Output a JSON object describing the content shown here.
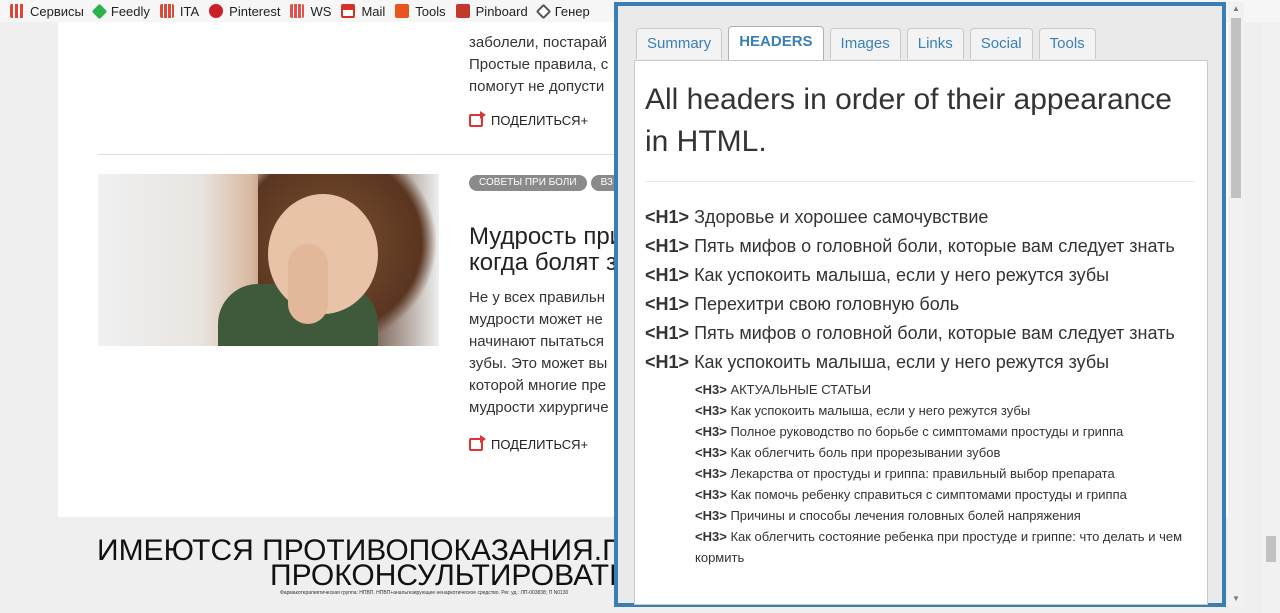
{
  "bookmarks": [
    {
      "label": "Сервисы",
      "icon": "apps-grid-icon",
      "color": "#e34234"
    },
    {
      "label": "Feedly",
      "icon": "feedly-icon",
      "color": "#2bb24c"
    },
    {
      "label": "ITA",
      "icon": "ita-icon",
      "color": "#d84a3a"
    },
    {
      "label": "Pinterest",
      "icon": "pinterest-icon",
      "color": "#cb2027"
    },
    {
      "label": "WS",
      "icon": "ws-icon",
      "color": "#e0524b"
    },
    {
      "label": "Mail",
      "icon": "gmail-icon",
      "color": "#d93025"
    },
    {
      "label": "Tools",
      "icon": "tools-arrow-icon",
      "color": "#e8541e"
    },
    {
      "label": "Pinboard",
      "icon": "pinboard-icon",
      "color": "#c0392b"
    },
    {
      "label": "Генер",
      "icon": "pen-icon",
      "color": "#555555"
    }
  ],
  "article1": {
    "lines": [
      "заболели, постарай",
      "Простые правила, с",
      "помогут не допусти"
    ],
    "share_label": "ПОДЕЛИТЬСЯ+"
  },
  "article2": {
    "tags": [
      "СОВЕТЫ ПРИ БОЛИ",
      "ВЗ"
    ],
    "title": [
      "Мудрость при",
      "когда болят з"
    ],
    "lines": [
      "Не у всех правильн",
      "мудрости может не",
      "начинают пытаться",
      "зубы. Это может вы",
      "которой многие пре",
      "мудрости хирургиче"
    ],
    "share_label": "ПОДЕЛИТЬСЯ+"
  },
  "banner": {
    "line1": "ИМЕЮТСЯ ПРОТИВОПОКАЗАНИЯ.П",
    "line2": "ПРОКОНСУЛЬТИРОВАТЬ",
    "fine_print": "Фармакотерапевтическая группа: НПВП. НПВП+анальгезирующее ненаркотическое средство. Рег. уд.: ЛП-003838; П N0130"
  },
  "popup": {
    "tabs": [
      "Summary",
      "HEADERS",
      "Images",
      "Links",
      "Social",
      "Tools"
    ],
    "active_tab": "HEADERS",
    "heading": "All headers in order of their appearance in HTML.",
    "h1_items": [
      {
        "tag": "<H1>",
        "text": "Здоровье и хорошее самочувствие"
      },
      {
        "tag": "<H1>",
        "text": "Пять мифов о головной боли, которые вам следует знать"
      },
      {
        "tag": "<H1>",
        "text": "Как успокоить малыша, если у него режутся зубы"
      },
      {
        "tag": "<H1>",
        "text": "Перехитри свою головную боль"
      },
      {
        "tag": "<H1>",
        "text": "Пять мифов о головной боли, которые вам следует знать"
      },
      {
        "tag": "<H1>",
        "text": "Как успокоить малыша, если у него режутся зубы"
      }
    ],
    "h3_items": [
      {
        "tag": "<H3>",
        "text": "АКТУАЛЬНЫЕ СТАТЬИ"
      },
      {
        "tag": "<H3>",
        "text": "Как успокоить малыша, если у него режутся зубы"
      },
      {
        "tag": "<H3>",
        "text": "Полное руководство по борьбе с симптомами простуды и гриппа"
      },
      {
        "tag": "<H3>",
        "text": "Как облегчить боль при прорезывании зубов"
      },
      {
        "tag": "<H3>",
        "text": "Лекарства от простуды и гриппа: правильный выбор препарата"
      },
      {
        "tag": "<H3>",
        "text": "Как помочь ребенку справиться с симптомами простуды и гриппа"
      },
      {
        "tag": "<H3>",
        "text": "Причины и способы лечения головных болей напряжения"
      },
      {
        "tag": "<H3>",
        "text": "Как облегчить состояние ребенка при простуде и гриппе: что делать и чем кормить"
      }
    ]
  },
  "colors": {
    "accent": "#3a7fb4",
    "share_icon": "#dd3333",
    "tag_bg": "#8a8a8a"
  }
}
